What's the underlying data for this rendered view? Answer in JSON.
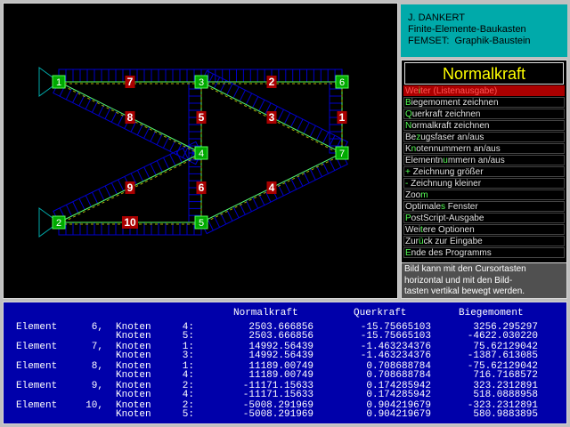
{
  "info": {
    "line1": "J. DANKERT",
    "line2": "Finite-Elemente-Baukasten",
    "line3": "FEMSET:  Graphik-Baustein"
  },
  "menu": {
    "title": "Normalkraft",
    "items": [
      {
        "pre": "We",
        "hk": "i",
        "post": "ter (Listenausgabe)",
        "selected": true
      },
      {
        "pre": "",
        "hk": "B",
        "post": "iegemoment zeichnen"
      },
      {
        "pre": "",
        "hk": "Q",
        "post": "uerkraft zeichnen"
      },
      {
        "pre": "",
        "hk": "N",
        "post": "ormalkraft zeichnen"
      },
      {
        "pre": "Be",
        "hk": "z",
        "post": "ugsfaser an/aus"
      },
      {
        "pre": "K",
        "hk": "n",
        "post": "otennummern an/aus"
      },
      {
        "pre": "Elementn",
        "hk": "u",
        "post": "mmern an/aus"
      },
      {
        "pre": "",
        "hk": "+",
        "post": " Zeichnung größer"
      },
      {
        "pre": "",
        "hk": "-",
        "post": " Zeichnung kleiner"
      },
      {
        "pre": "Zoo",
        "hk": "m",
        "post": ""
      },
      {
        "pre": "Optimale",
        "hk": "s",
        "post": " Fenster"
      },
      {
        "pre": "",
        "hk": "P",
        "post": "ostScript-Ausgabe"
      },
      {
        "pre": "Wei",
        "hk": "t",
        "post": "ere Optionen"
      },
      {
        "pre": "Zur",
        "hk": "ü",
        "post": "ck zur Eingabe"
      },
      {
        "pre": "",
        "hk": "E",
        "post": "nde des Programms"
      }
    ]
  },
  "help": {
    "line1": "Bild kann mit den Cursortasten",
    "line2": "horizontal und mit den Bild-",
    "line3": "tasten vertikal bewegt werden."
  },
  "table": {
    "headers": [
      "Normalkraft",
      "Querkraft",
      "Biegemoment"
    ],
    "rows": [
      {
        "element": "Element",
        "num": "6,",
        "knoten": [
          "Knoten",
          "Knoten"
        ],
        "nodes": [
          "4:",
          "5:"
        ],
        "n": [
          "2503.666856",
          "2503.666856"
        ],
        "q": [
          "-15.75665103",
          "-15.75665103"
        ],
        "m": [
          "3256.295297",
          "-4622.030220"
        ]
      },
      {
        "element": "Element",
        "num": "7,",
        "knoten": [
          "Knoten",
          "Knoten"
        ],
        "nodes": [
          "1:",
          "3:"
        ],
        "n": [
          "14992.56439",
          "14992.56439"
        ],
        "q": [
          "-1.463234376",
          "-1.463234376"
        ],
        "m": [
          "75.62129042",
          "-1387.613085"
        ]
      },
      {
        "element": "Element",
        "num": "8,",
        "knoten": [
          "Knoten",
          "Knoten"
        ],
        "nodes": [
          "1:",
          "4:"
        ],
        "n": [
          "11189.00749",
          "11189.00749"
        ],
        "q": [
          "0.708688784",
          "0.708688784"
        ],
        "m": [
          "-75.62129042",
          "716.7168572"
        ]
      },
      {
        "element": "Element",
        "num": "9,",
        "knoten": [
          "Knoten",
          "Knoten"
        ],
        "nodes": [
          "2:",
          "4:"
        ],
        "n": [
          "-11171.15633",
          "-11171.15633"
        ],
        "q": [
          "0.174285942",
          "0.174285942"
        ],
        "m": [
          "323.2312891",
          "518.0888958"
        ]
      },
      {
        "element": "Element",
        "num": "10,",
        "knoten": [
          "Knoten",
          "Knoten"
        ],
        "nodes": [
          "2:",
          "5:"
        ],
        "n": [
          "-5008.291969",
          "-5008.291969"
        ],
        "q": [
          "0.904219679",
          "0.904219679"
        ],
        "m": [
          "-323.2312891",
          "580.9883895"
        ]
      }
    ]
  },
  "structure": {
    "nodes": [
      "1",
      "2",
      "3",
      "4",
      "5",
      "6",
      "7"
    ],
    "elements": [
      "1",
      "2",
      "3",
      "4",
      "5",
      "6",
      "7",
      "8",
      "9",
      "10"
    ]
  },
  "colors": {
    "node": "#00aa00",
    "element": "#aa0000",
    "member": "#55ff55",
    "diagram": "#0000cc",
    "selected": "#aa0000"
  }
}
